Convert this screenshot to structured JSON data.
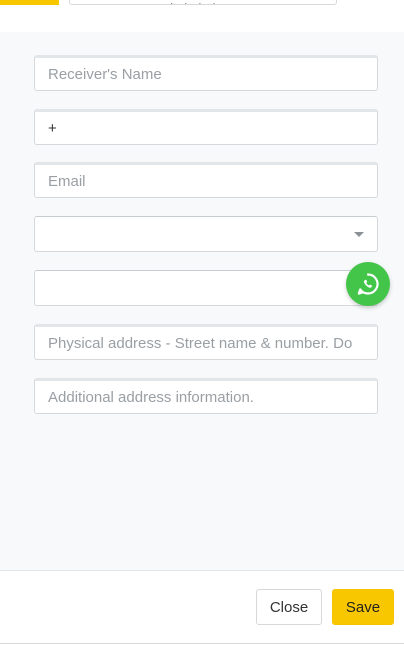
{
  "colors": {
    "accent": "#f9c700",
    "whatsapp": "#42c549",
    "body_bg": "#f7f9fa"
  },
  "form": {
    "receiver_name_placeholder": "Receiver's Name",
    "phone_value": "+",
    "email_placeholder": "Email",
    "select_value": "",
    "blank_field_value": "",
    "address_placeholder": "Physical address - Street name & number. Do",
    "additional_placeholder": "Additional address information."
  },
  "whatsapp": {
    "icon": "whatsapp-icon"
  },
  "footer": {
    "close_label": "Close",
    "save_label": "Save"
  }
}
